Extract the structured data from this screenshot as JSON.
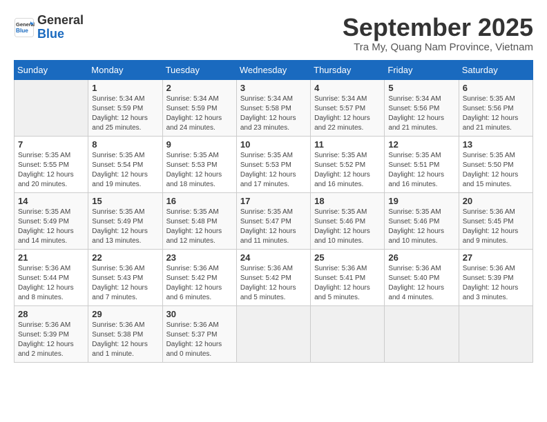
{
  "header": {
    "logo_line1": "General",
    "logo_line2": "Blue",
    "month": "September 2025",
    "location": "Tra My, Quang Nam Province, Vietnam"
  },
  "weekdays": [
    "Sunday",
    "Monday",
    "Tuesday",
    "Wednesday",
    "Thursday",
    "Friday",
    "Saturday"
  ],
  "weeks": [
    [
      {
        "day": "",
        "info": ""
      },
      {
        "day": "1",
        "info": "Sunrise: 5:34 AM\nSunset: 5:59 PM\nDaylight: 12 hours\nand 25 minutes."
      },
      {
        "day": "2",
        "info": "Sunrise: 5:34 AM\nSunset: 5:59 PM\nDaylight: 12 hours\nand 24 minutes."
      },
      {
        "day": "3",
        "info": "Sunrise: 5:34 AM\nSunset: 5:58 PM\nDaylight: 12 hours\nand 23 minutes."
      },
      {
        "day": "4",
        "info": "Sunrise: 5:34 AM\nSunset: 5:57 PM\nDaylight: 12 hours\nand 22 minutes."
      },
      {
        "day": "5",
        "info": "Sunrise: 5:34 AM\nSunset: 5:56 PM\nDaylight: 12 hours\nand 21 minutes."
      },
      {
        "day": "6",
        "info": "Sunrise: 5:35 AM\nSunset: 5:56 PM\nDaylight: 12 hours\nand 21 minutes."
      }
    ],
    [
      {
        "day": "7",
        "info": "Sunrise: 5:35 AM\nSunset: 5:55 PM\nDaylight: 12 hours\nand 20 minutes."
      },
      {
        "day": "8",
        "info": "Sunrise: 5:35 AM\nSunset: 5:54 PM\nDaylight: 12 hours\nand 19 minutes."
      },
      {
        "day": "9",
        "info": "Sunrise: 5:35 AM\nSunset: 5:53 PM\nDaylight: 12 hours\nand 18 minutes."
      },
      {
        "day": "10",
        "info": "Sunrise: 5:35 AM\nSunset: 5:53 PM\nDaylight: 12 hours\nand 17 minutes."
      },
      {
        "day": "11",
        "info": "Sunrise: 5:35 AM\nSunset: 5:52 PM\nDaylight: 12 hours\nand 16 minutes."
      },
      {
        "day": "12",
        "info": "Sunrise: 5:35 AM\nSunset: 5:51 PM\nDaylight: 12 hours\nand 16 minutes."
      },
      {
        "day": "13",
        "info": "Sunrise: 5:35 AM\nSunset: 5:50 PM\nDaylight: 12 hours\nand 15 minutes."
      }
    ],
    [
      {
        "day": "14",
        "info": "Sunrise: 5:35 AM\nSunset: 5:49 PM\nDaylight: 12 hours\nand 14 minutes."
      },
      {
        "day": "15",
        "info": "Sunrise: 5:35 AM\nSunset: 5:49 PM\nDaylight: 12 hours\nand 13 minutes."
      },
      {
        "day": "16",
        "info": "Sunrise: 5:35 AM\nSunset: 5:48 PM\nDaylight: 12 hours\nand 12 minutes."
      },
      {
        "day": "17",
        "info": "Sunrise: 5:35 AM\nSunset: 5:47 PM\nDaylight: 12 hours\nand 11 minutes."
      },
      {
        "day": "18",
        "info": "Sunrise: 5:35 AM\nSunset: 5:46 PM\nDaylight: 12 hours\nand 10 minutes."
      },
      {
        "day": "19",
        "info": "Sunrise: 5:35 AM\nSunset: 5:46 PM\nDaylight: 12 hours\nand 10 minutes."
      },
      {
        "day": "20",
        "info": "Sunrise: 5:36 AM\nSunset: 5:45 PM\nDaylight: 12 hours\nand 9 minutes."
      }
    ],
    [
      {
        "day": "21",
        "info": "Sunrise: 5:36 AM\nSunset: 5:44 PM\nDaylight: 12 hours\nand 8 minutes."
      },
      {
        "day": "22",
        "info": "Sunrise: 5:36 AM\nSunset: 5:43 PM\nDaylight: 12 hours\nand 7 minutes."
      },
      {
        "day": "23",
        "info": "Sunrise: 5:36 AM\nSunset: 5:42 PM\nDaylight: 12 hours\nand 6 minutes."
      },
      {
        "day": "24",
        "info": "Sunrise: 5:36 AM\nSunset: 5:42 PM\nDaylight: 12 hours\nand 5 minutes."
      },
      {
        "day": "25",
        "info": "Sunrise: 5:36 AM\nSunset: 5:41 PM\nDaylight: 12 hours\nand 5 minutes."
      },
      {
        "day": "26",
        "info": "Sunrise: 5:36 AM\nSunset: 5:40 PM\nDaylight: 12 hours\nand 4 minutes."
      },
      {
        "day": "27",
        "info": "Sunrise: 5:36 AM\nSunset: 5:39 PM\nDaylight: 12 hours\nand 3 minutes."
      }
    ],
    [
      {
        "day": "28",
        "info": "Sunrise: 5:36 AM\nSunset: 5:39 PM\nDaylight: 12 hours\nand 2 minutes."
      },
      {
        "day": "29",
        "info": "Sunrise: 5:36 AM\nSunset: 5:38 PM\nDaylight: 12 hours\nand 1 minute."
      },
      {
        "day": "30",
        "info": "Sunrise: 5:36 AM\nSunset: 5:37 PM\nDaylight: 12 hours\nand 0 minutes."
      },
      {
        "day": "",
        "info": ""
      },
      {
        "day": "",
        "info": ""
      },
      {
        "day": "",
        "info": ""
      },
      {
        "day": "",
        "info": ""
      }
    ]
  ]
}
